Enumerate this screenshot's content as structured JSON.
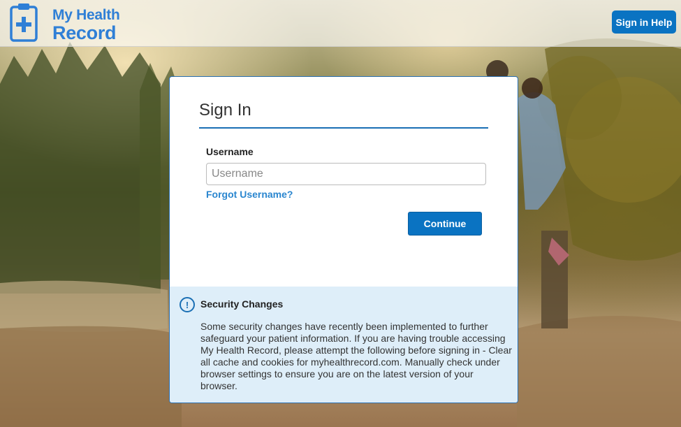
{
  "header": {
    "logo_line1": "My Health",
    "logo_line2": "Record",
    "help_button": "Sign in Help"
  },
  "signin": {
    "title": "Sign In",
    "username_label": "Username",
    "username_placeholder": "Username",
    "username_value": "",
    "forgot_link": "Forgot Username?",
    "continue_button": "Continue"
  },
  "notice": {
    "icon": "info-icon",
    "title": "Security Changes",
    "body": "Some security changes have recently been implemented to further safeguard your patient information. If you are having trouble accessing My Health Record, please attempt the following before signing in - Clear all cache and cookies for myhealthrecord.com. Manually check under browser settings to ensure you are on the latest version of your browser."
  },
  "colors": {
    "brand_blue": "#2f7fd6",
    "button_blue": "#0a73c2",
    "notice_bg": "#deeef9"
  }
}
